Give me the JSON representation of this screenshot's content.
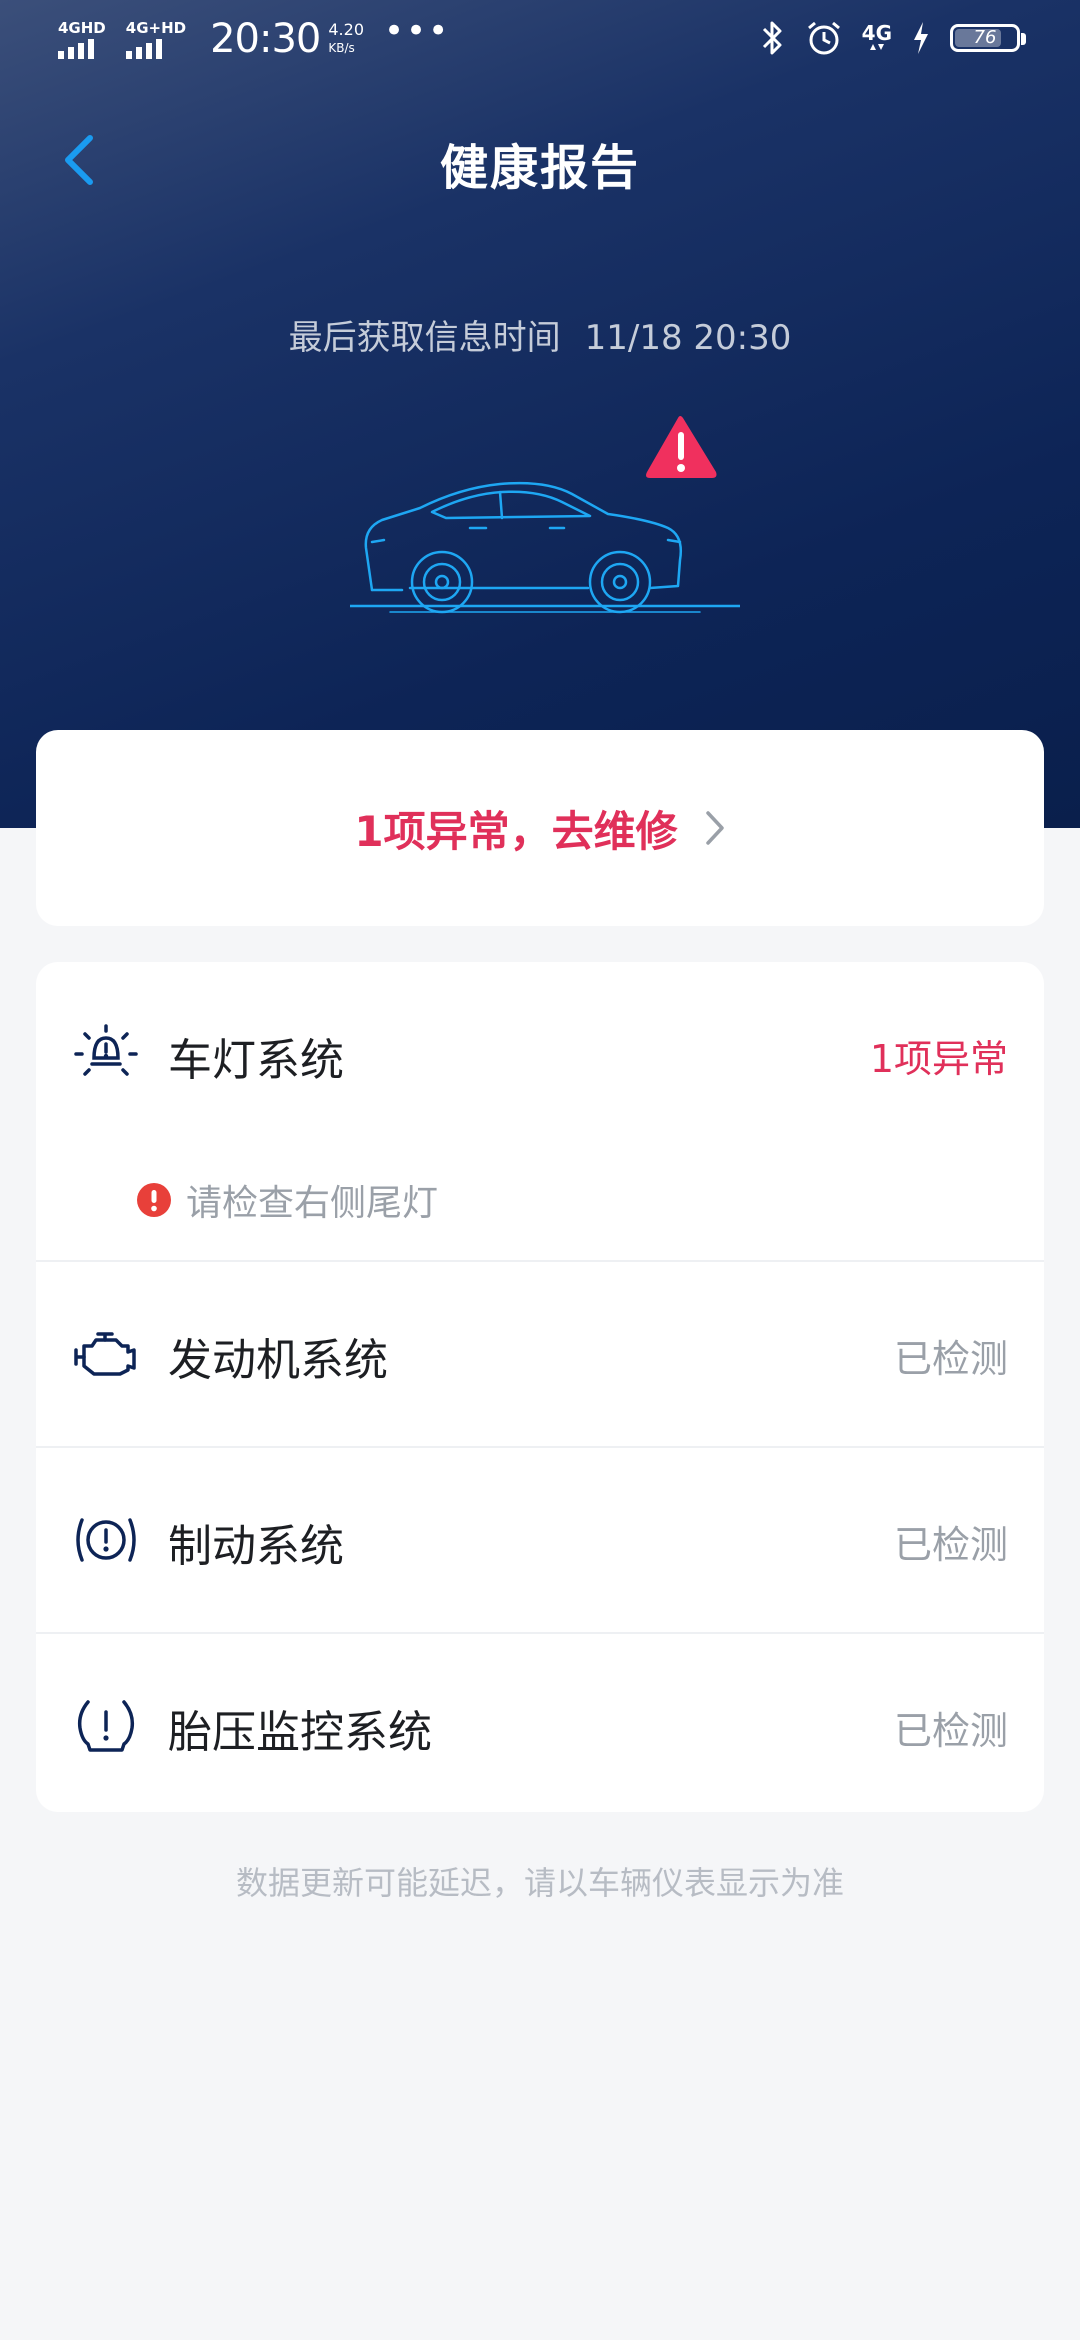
{
  "status_bar": {
    "sim1_label": "4GHD",
    "sim2_label": "4G+HD",
    "time": "20:30",
    "speed_value": "4.20",
    "speed_unit": "KB/s",
    "more": "•••",
    "net_label": "4G",
    "battery_level": "76",
    "battery_fraction": 0.76
  },
  "header": {
    "title": "健康报告",
    "last_fetch_label": "最后获取信息时间",
    "last_fetch_time": "11/18 20:30"
  },
  "colors": {
    "accent_blue": "#1a9bf0",
    "alert_red": "#e0305a",
    "car_outline": "#1ea7f3"
  },
  "alert": {
    "text": "1项异常，去维修"
  },
  "systems": [
    {
      "icon": "headlight-icon",
      "name": "车灯系统",
      "status": "1项异常",
      "warning": "请检查右侧尾灯"
    },
    {
      "icon": "engine-icon",
      "name": "发动机系统",
      "status": "已检测"
    },
    {
      "icon": "brake-icon",
      "name": "制动系统",
      "status": "已检测"
    },
    {
      "icon": "tire-pressure-icon",
      "name": "胎压监控系统",
      "status": "已检测"
    }
  ],
  "footnote": "数据更新可能延迟，请以车辆仪表显示为准"
}
